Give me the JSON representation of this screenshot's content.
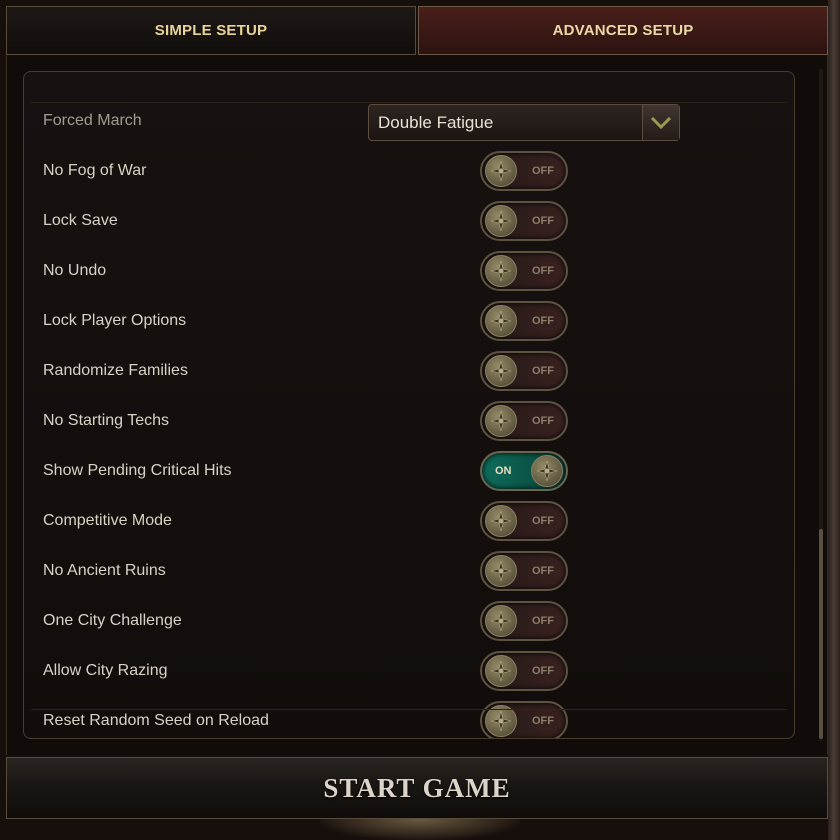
{
  "tabs": {
    "simple": "SIMPLE SETUP",
    "advanced": "ADVANCED SETUP"
  },
  "forced_march": {
    "label": "Forced March",
    "value": "Double Fatigue"
  },
  "options": [
    {
      "label": "No Fog of War",
      "state": "OFF"
    },
    {
      "label": "Lock Save",
      "state": "OFF"
    },
    {
      "label": "No Undo",
      "state": "OFF"
    },
    {
      "label": "Lock Player Options",
      "state": "OFF"
    },
    {
      "label": "Randomize Families",
      "state": "OFF"
    },
    {
      "label": "No Starting Techs",
      "state": "OFF"
    },
    {
      "label": "Show Pending Critical Hits",
      "state": "ON"
    },
    {
      "label": "Competitive Mode",
      "state": "OFF"
    },
    {
      "label": "No Ancient Ruins",
      "state": "OFF"
    },
    {
      "label": "One City Challenge",
      "state": "OFF"
    },
    {
      "label": "Allow City Razing",
      "state": "OFF"
    },
    {
      "label": "Reset Random Seed on Reload",
      "state": "OFF"
    }
  ],
  "start_button": "START GAME",
  "colors": {
    "accent_gold": "#e8d49a",
    "toggle_on": "#0f6e5c",
    "advanced_tab_bg": "#4a1f1a"
  },
  "icons": {
    "dropdown": "chevron-down-icon",
    "knob": "compass-rose-icon"
  }
}
